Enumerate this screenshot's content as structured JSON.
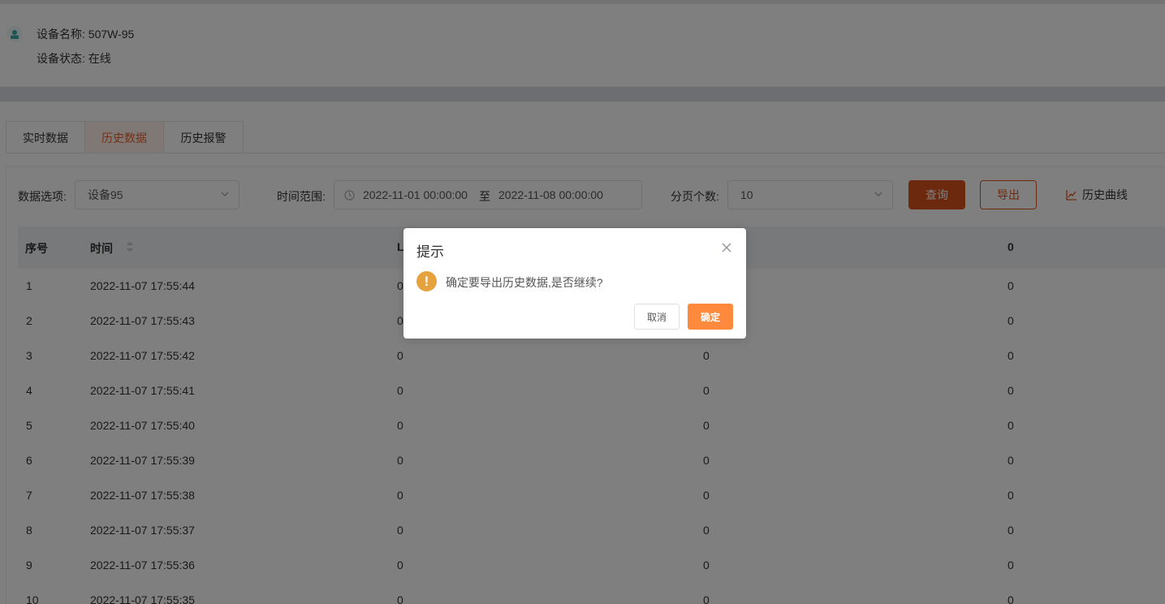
{
  "device": {
    "name": "设备名称: 507W-95",
    "status": "设备状态: 在线"
  },
  "tabs": [
    {
      "label": "实时数据",
      "active": false
    },
    {
      "label": "历史数据",
      "active": true
    },
    {
      "label": "历史报警",
      "active": false
    }
  ],
  "filters": {
    "data_option_label": "数据选项:",
    "data_option_value": "设备95",
    "time_range_label": "时间范围:",
    "start": "2022-11-01 00:00:00",
    "range_sep": "至",
    "end": "2022-11-08 00:00:00",
    "page_size_label": "分页个数:",
    "page_size_value": "10",
    "query_button": "查询",
    "export_button": "导出",
    "curve_button": "历史曲线"
  },
  "table": {
    "headers": [
      "序号",
      "时间",
      "L",
      "",
      "0"
    ],
    "rows": [
      {
        "index": "1",
        "time": "2022-11-07 17:55:44",
        "c1": "0",
        "c2": "",
        "c3": "0"
      },
      {
        "index": "2",
        "time": "2022-11-07 17:55:43",
        "c1": "0",
        "c2": "",
        "c3": "0"
      },
      {
        "index": "3",
        "time": "2022-11-07 17:55:42",
        "c1": "0",
        "c2": "0",
        "c3": "0"
      },
      {
        "index": "4",
        "time": "2022-11-07 17:55:41",
        "c1": "0",
        "c2": "0",
        "c3": "0"
      },
      {
        "index": "5",
        "time": "2022-11-07 17:55:40",
        "c1": "0",
        "c2": "0",
        "c3": "0"
      },
      {
        "index": "6",
        "time": "2022-11-07 17:55:39",
        "c1": "0",
        "c2": "0",
        "c3": "0"
      },
      {
        "index": "7",
        "time": "2022-11-07 17:55:38",
        "c1": "0",
        "c2": "0",
        "c3": "0"
      },
      {
        "index": "8",
        "time": "2022-11-07 17:55:37",
        "c1": "0",
        "c2": "0",
        "c3": "0"
      },
      {
        "index": "9",
        "time": "2022-11-07 17:55:36",
        "c1": "0",
        "c2": "0",
        "c3": "0"
      },
      {
        "index": "10",
        "time": "2022-11-07 17:55:35",
        "c1": "0",
        "c2": "0",
        "c3": "0"
      }
    ]
  },
  "dialog": {
    "title": "提示",
    "message": "确定要导出历史数据,是否继续?",
    "warning_glyph": "!",
    "cancel": "取消",
    "confirm": "确定"
  },
  "colors": {
    "accent": "#d9531a",
    "active_tab": "#e8602c",
    "warning": "#e6a23c",
    "confirm": "#ff8a3d"
  }
}
